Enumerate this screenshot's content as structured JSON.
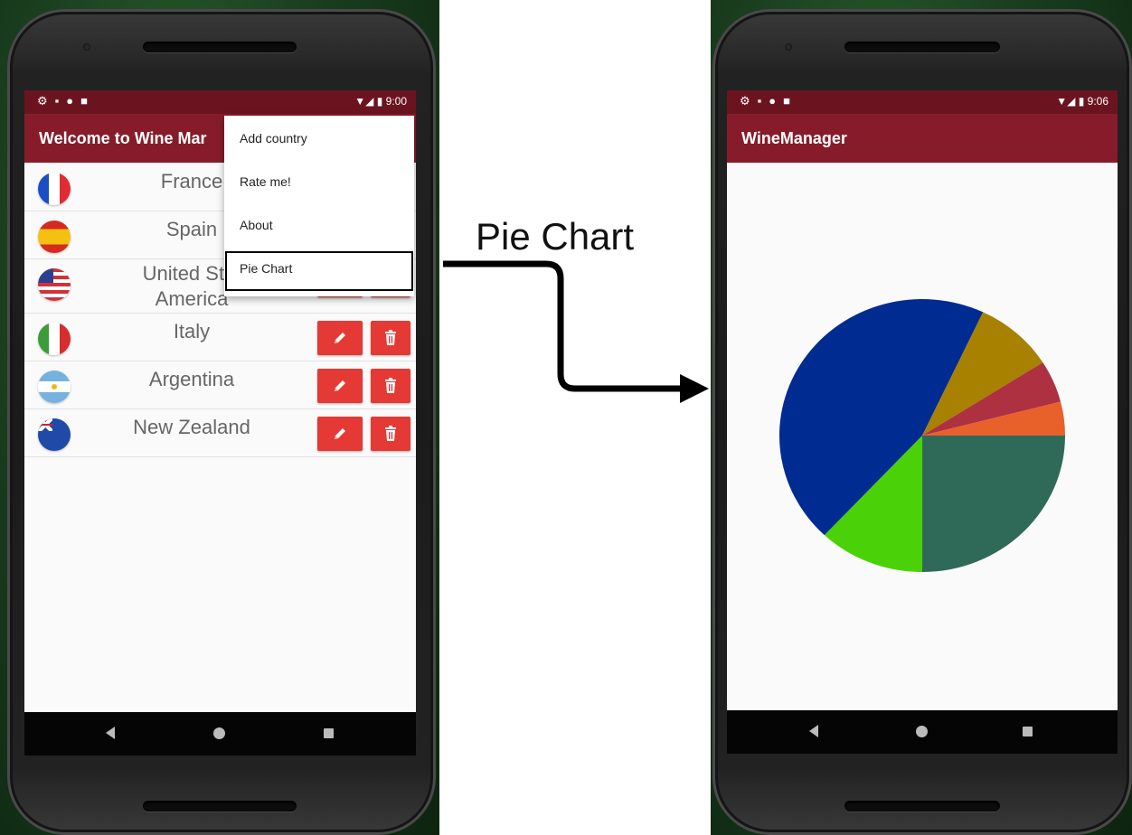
{
  "caption": "Pie Chart",
  "left_phone": {
    "status_time": "9:00",
    "app_title": "Welcome to Wine Mar",
    "countries": [
      {
        "name": "France"
      },
      {
        "name": "Spain"
      },
      {
        "name": "United States of America",
        "line1": "United Stat",
        "line2": "America"
      },
      {
        "name": "Italy"
      },
      {
        "name": "Argentina"
      },
      {
        "name": "New Zealand"
      }
    ],
    "menu": [
      {
        "label": "Add country"
      },
      {
        "label": "Rate me!"
      },
      {
        "label": "About"
      },
      {
        "label": "Pie Chart",
        "highlighted": true
      }
    ]
  },
  "right_phone": {
    "status_time": "9:06",
    "app_title": "WineManager"
  },
  "chart_data": {
    "type": "pie",
    "title": "",
    "slices": [
      {
        "value": 25,
        "color": "#2e6a57"
      },
      {
        "value": 12,
        "color": "#4bd107"
      },
      {
        "value": 45,
        "color": "#002b90"
      },
      {
        "value": 9,
        "color": "#a88100"
      },
      {
        "value": 5,
        "color": "#ad3141"
      },
      {
        "value": 4,
        "color": "#e8602a"
      }
    ]
  },
  "colors": {
    "status_bar": "#6b1420",
    "toolbar": "#861c2a",
    "action_button": "#e53935"
  }
}
